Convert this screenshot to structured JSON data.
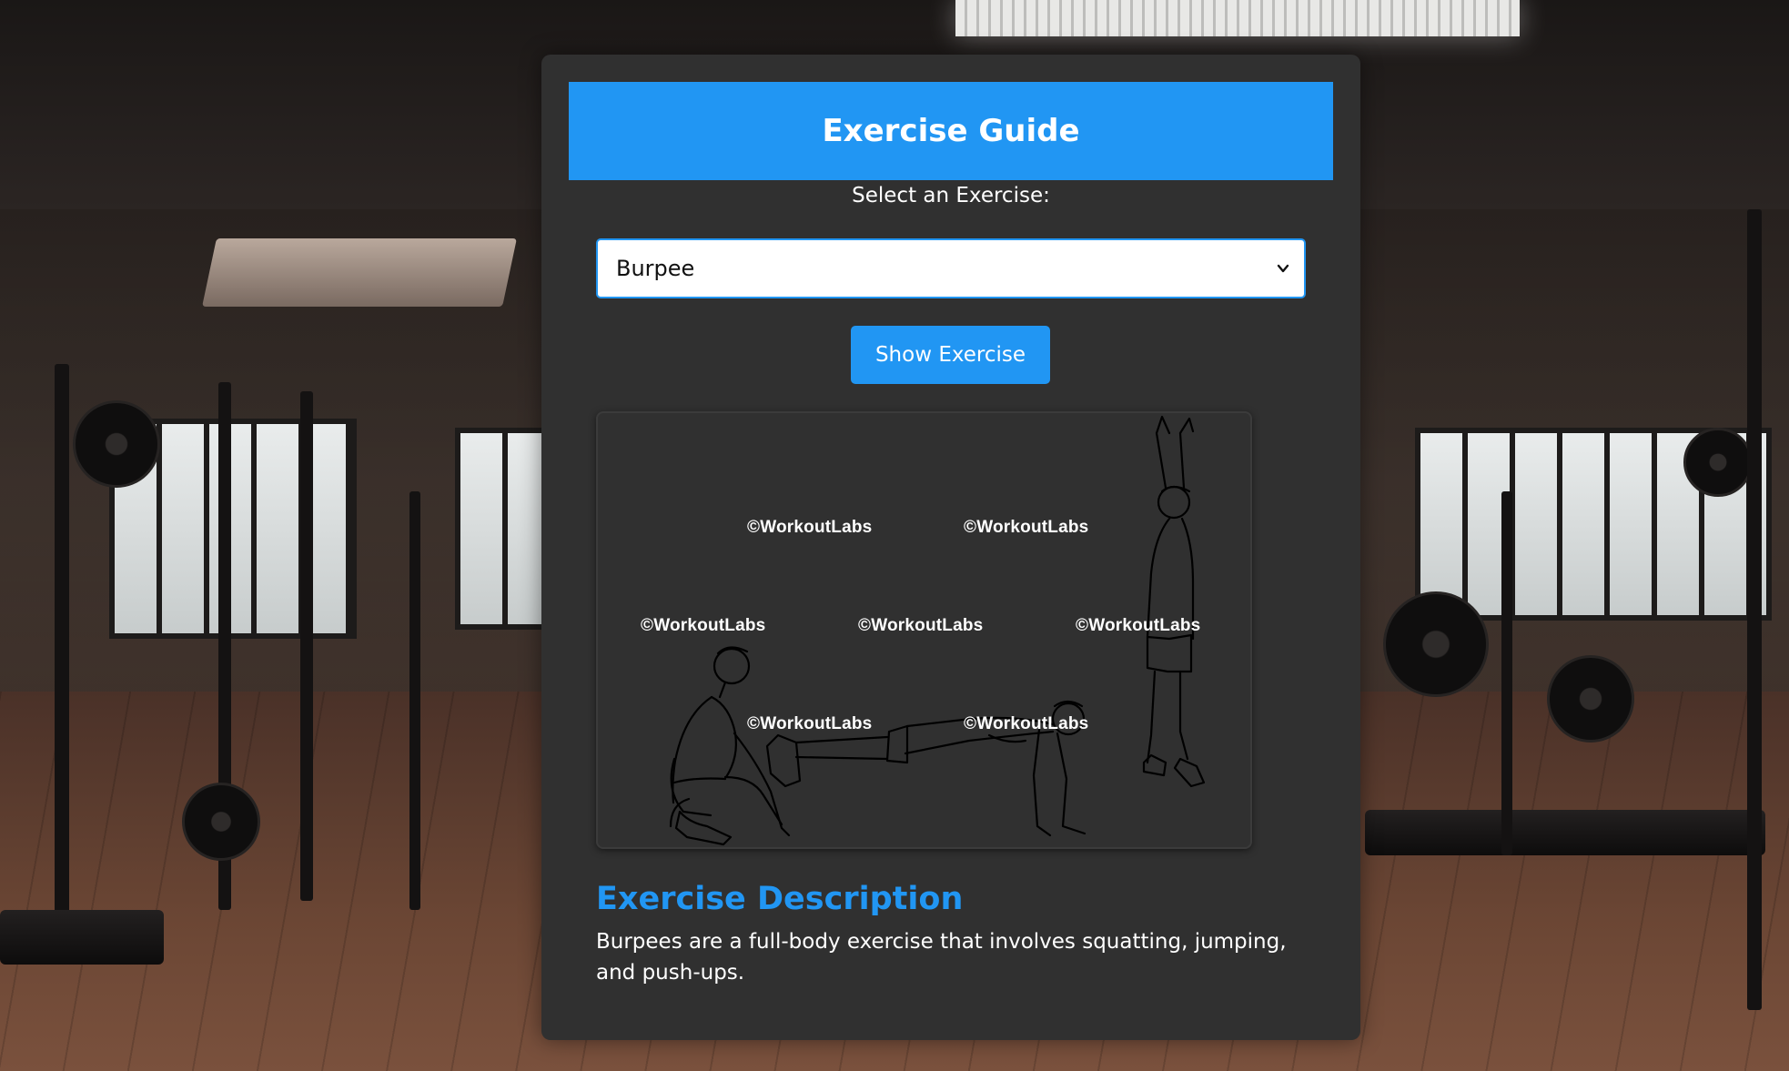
{
  "page": {
    "title": "Exercise Guide"
  },
  "form": {
    "select_label": "Select an Exercise:",
    "selected_exercise": "Burpee",
    "show_button_label": "Show Exercise"
  },
  "image": {
    "watermark_text": "©WorkoutLabs",
    "watermarks": [
      "©WorkoutLabs",
      "©WorkoutLabs",
      "©WorkoutLabs",
      "©WorkoutLabs",
      "©WorkoutLabs",
      "©WorkoutLabs",
      "©WorkoutLabs"
    ],
    "subject": "burpee-illustration"
  },
  "description": {
    "heading": "Exercise Description",
    "text": "Burpees are a full-body exercise that involves squatting, jumping, and push-ups."
  },
  "colors": {
    "accent": "#2196f3",
    "card_background": "#303030",
    "text": "#ffffff"
  },
  "icons": {
    "select_chevron": "chevron-down-icon"
  }
}
